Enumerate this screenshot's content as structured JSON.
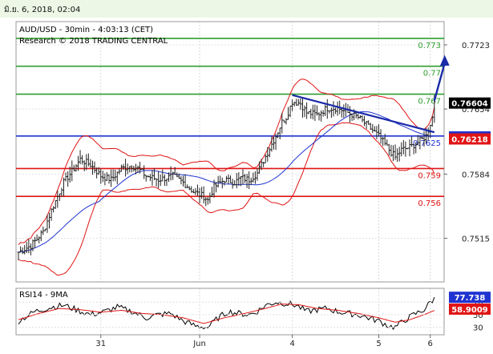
{
  "header": {
    "timestamp": "มิ.ย. 6, 2018, 02:04"
  },
  "chart_data": [
    {
      "type": "candlestick",
      "title": "AUD/USD - 30min - 4:03:13 (CET)",
      "subtitle": "Research © 2018 TRADING CENTRAL",
      "ylim": [
        0.7468,
        0.7748
      ],
      "y_ticks": [
        "0.7723",
        "0.7654",
        "0.7584",
        "0.7515"
      ],
      "x_ticks": [
        "31",
        "Jun",
        "4",
        "5",
        "6"
      ],
      "levels": [
        {
          "label": "0.773",
          "value": 0.773,
          "color": "#2e9e2e"
        },
        {
          "label": "0.77",
          "value": 0.77,
          "color": "#2e9e2e"
        },
        {
          "label": "0.767",
          "value": 0.767,
          "color": "#2e9e2e"
        },
        {
          "label": "0.7625",
          "value": 0.7625,
          "color": "#1f33d1"
        },
        {
          "label": "0.759",
          "value": 0.759,
          "color": "#e01515"
        },
        {
          "label": "0.756",
          "value": 0.756,
          "color": "#e01515"
        }
      ],
      "price_badges": [
        {
          "label": "0.76604",
          "value": 0.76604,
          "bg": "#000000",
          "fg": "#ffffff"
        },
        {
          "label": "0.76240",
          "value": 0.7624,
          "bg": "#1f33d1",
          "fg": "#ffffff"
        },
        {
          "label": "0.76218",
          "value": 0.76218,
          "bg": "#e01515",
          "fg": "#ffffff"
        }
      ],
      "close_path": [
        [
          0,
          0.75
        ],
        [
          6,
          0.7507
        ],
        [
          12,
          0.7522
        ],
        [
          16,
          0.7545
        ],
        [
          22,
          0.7575
        ],
        [
          27,
          0.759
        ],
        [
          30,
          0.76
        ],
        [
          35,
          0.7594
        ],
        [
          40,
          0.7582
        ],
        [
          45,
          0.7578
        ],
        [
          50,
          0.759
        ],
        [
          55,
          0.7593
        ],
        [
          58,
          0.759
        ],
        [
          62,
          0.7582
        ],
        [
          68,
          0.7578
        ],
        [
          72,
          0.758
        ],
        [
          75,
          0.7582
        ],
        [
          80,
          0.7575
        ],
        [
          85,
          0.7565
        ],
        [
          90,
          0.756
        ],
        [
          92,
          0.7556
        ],
        [
          95,
          0.757
        ],
        [
          100,
          0.7578
        ],
        [
          105,
          0.7575
        ],
        [
          108,
          0.758
        ],
        [
          112,
          0.7578
        ],
        [
          116,
          0.7585
        ],
        [
          120,
          0.7603
        ],
        [
          125,
          0.7625
        ],
        [
          128,
          0.764
        ],
        [
          130,
          0.7645
        ],
        [
          133,
          0.7662
        ],
        [
          137,
          0.766
        ],
        [
          140,
          0.765
        ],
        [
          145,
          0.7648
        ],
        [
          150,
          0.7655
        ],
        [
          155,
          0.7655
        ],
        [
          160,
          0.765
        ],
        [
          165,
          0.7645
        ],
        [
          170,
          0.7635
        ],
        [
          175,
          0.7625
        ],
        [
          180,
          0.761
        ],
        [
          183,
          0.7602
        ],
        [
          186,
          0.761
        ],
        [
          190,
          0.7613
        ],
        [
          194,
          0.7618
        ],
        [
          198,
          0.7625
        ],
        [
          201,
          0.7645
        ],
        [
          202,
          0.7663
        ]
      ],
      "trendline": [
        [
          133,
          0.7669
        ],
        [
          202,
          0.7629
        ]
      ],
      "projection_arrow": [
        [
          202,
          0.7663
        ],
        [
          207,
          0.7712
        ]
      ],
      "bar_count": 205
    },
    {
      "type": "line",
      "title": "RSI14 - 9MA",
      "y_ticks": [
        "70",
        "50",
        "30"
      ],
      "ylim": [
        18,
        92
      ],
      "series": [
        {
          "name": "RSI14",
          "color": "#000000",
          "points": [
            [
              0,
              40
            ],
            [
              8,
              55
            ],
            [
              16,
              62
            ],
            [
              22,
              65
            ],
            [
              28,
              58
            ],
            [
              35,
              50
            ],
            [
              42,
              55
            ],
            [
              48,
              62
            ],
            [
              55,
              55
            ],
            [
              62,
              45
            ],
            [
              68,
              50
            ],
            [
              74,
              52
            ],
            [
              80,
              40
            ],
            [
              86,
              32
            ],
            [
              92,
              30
            ],
            [
              97,
              45
            ],
            [
              102,
              55
            ],
            [
              107,
              52
            ],
            [
              112,
              50
            ],
            [
              116,
              55
            ],
            [
              120,
              65
            ],
            [
              125,
              70
            ],
            [
              130,
              68
            ],
            [
              135,
              65
            ],
            [
              140,
              55
            ],
            [
              145,
              58
            ],
            [
              150,
              60
            ],
            [
              155,
              55
            ],
            [
              160,
              52
            ],
            [
              165,
              50
            ],
            [
              170,
              45
            ],
            [
              175,
              40
            ],
            [
              180,
              32
            ],
            [
              183,
              30
            ],
            [
              187,
              40
            ],
            [
              192,
              50
            ],
            [
              197,
              58
            ],
            [
              200,
              70
            ],
            [
              203,
              78
            ]
          ]
        },
        {
          "name": "9MA",
          "color": "#e01515",
          "points": [
            [
              0,
              42
            ],
            [
              10,
              52
            ],
            [
              20,
              60
            ],
            [
              30,
              58
            ],
            [
              40,
              54
            ],
            [
              50,
              57
            ],
            [
              60,
              52
            ],
            [
              70,
              50
            ],
            [
              80,
              45
            ],
            [
              90,
              36
            ],
            [
              100,
              45
            ],
            [
              110,
              52
            ],
            [
              120,
              60
            ],
            [
              128,
              67
            ],
            [
              136,
              66
            ],
            [
              145,
              60
            ],
            [
              155,
              57
            ],
            [
              165,
              52
            ],
            [
              175,
              45
            ],
            [
              183,
              38
            ],
            [
              190,
              42
            ],
            [
              197,
              50
            ],
            [
              203,
              58
            ]
          ]
        }
      ],
      "value_badges": [
        {
          "label": "77.738",
          "value": 77.738,
          "bg": "#1f33d1",
          "fg": "#ffffff"
        },
        {
          "label": "58.9009",
          "value": 58.9009,
          "bg": "#e01515",
          "fg": "#ffffff"
        }
      ]
    }
  ]
}
